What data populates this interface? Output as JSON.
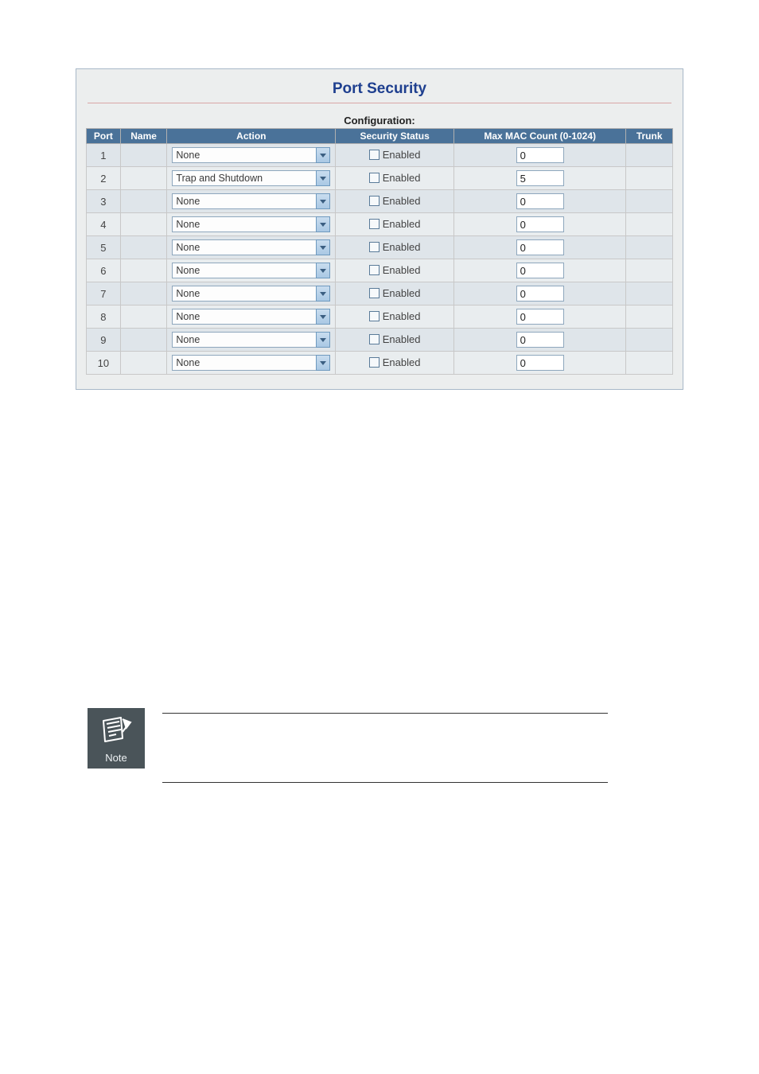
{
  "title": "Port Security",
  "subtitle": "Configuration:",
  "columns": {
    "port": "Port",
    "name": "Name",
    "action": "Action",
    "status": "Security Status",
    "mac": "Max MAC Count (0-1024)",
    "trunk": "Trunk"
  },
  "status_label": "Enabled",
  "rows": [
    {
      "port": "1",
      "name": "",
      "action": "None",
      "enabled": false,
      "mac": "0",
      "trunk": ""
    },
    {
      "port": "2",
      "name": "",
      "action": "Trap and Shutdown",
      "enabled": false,
      "mac": "5",
      "trunk": ""
    },
    {
      "port": "3",
      "name": "",
      "action": "None",
      "enabled": false,
      "mac": "0",
      "trunk": ""
    },
    {
      "port": "4",
      "name": "",
      "action": "None",
      "enabled": false,
      "mac": "0",
      "trunk": ""
    },
    {
      "port": "5",
      "name": "",
      "action": "None",
      "enabled": false,
      "mac": "0",
      "trunk": ""
    },
    {
      "port": "6",
      "name": "",
      "action": "None",
      "enabled": false,
      "mac": "0",
      "trunk": ""
    },
    {
      "port": "7",
      "name": "",
      "action": "None",
      "enabled": false,
      "mac": "0",
      "trunk": ""
    },
    {
      "port": "8",
      "name": "",
      "action": "None",
      "enabled": false,
      "mac": "0",
      "trunk": ""
    },
    {
      "port": "9",
      "name": "",
      "action": "None",
      "enabled": false,
      "mac": "0",
      "trunk": ""
    },
    {
      "port": "10",
      "name": "",
      "action": "None",
      "enabled": false,
      "mac": "0",
      "trunk": ""
    }
  ],
  "note_label": "Note"
}
